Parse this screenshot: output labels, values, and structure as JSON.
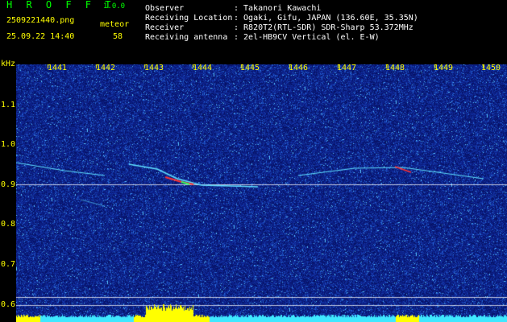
{
  "header": {
    "app_name": "H R O F F T",
    "version": "1.0.0",
    "filename": "2509221440.png",
    "datetime": "25.09.22 14:40",
    "mode_label": "meteor",
    "mode_count": "58",
    "info": [
      {
        "key": "Observer",
        "value": ": Takanori Kawachi"
      },
      {
        "key": "Receiving Location",
        "value": ": Ogaki, Gifu, JAPAN (136.60E, 35.35N)"
      },
      {
        "key": "Receiver",
        "value": ": R820T2(RTL-SDR) SDR-Sharp 53.372MHz"
      },
      {
        "key": "Receiving antenna",
        "value": ": 2el-HB9CV Vertical (el. E-W)"
      }
    ]
  },
  "axes": {
    "y_unit": "kHz",
    "y_ticks": [
      "1.1",
      "1.0",
      "0.9",
      "0.8",
      "0.7",
      "0.6"
    ],
    "x_ticks": [
      "1441",
      "1442",
      "1443",
      "1444",
      "1445",
      "1446",
      "1447",
      "1448",
      "1449",
      "1450"
    ]
  },
  "colors": {
    "background": "#000000",
    "spectrogram_bg": "#0c1f86",
    "label_yellow": "#ffff00",
    "label_green": "#00ff00",
    "label_white": "#ffffff",
    "trace_cyan": "#5fe0ff",
    "signal_red": "#ff3030",
    "signal_green": "#30ff60",
    "level_yellow": "#ffff00",
    "level_cyan": "#3fe8ff"
  }
}
